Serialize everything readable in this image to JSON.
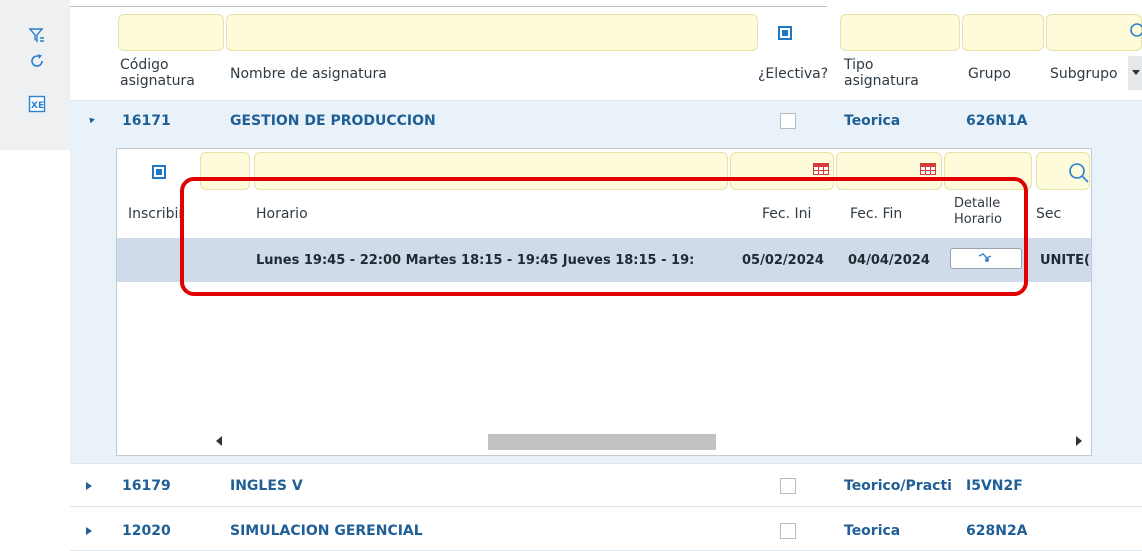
{
  "headers": {
    "codigo": "Código\nasignatura",
    "nombre": "Nombre de asignatura",
    "electiva": "¿Electiva?",
    "tipo": "Tipo\nasignatura",
    "grupo": "Grupo",
    "subgrupo": "Subgrupo"
  },
  "rows": [
    {
      "codigo": "16171",
      "nombre": "GESTION DE PRODUCCION",
      "tipo": "Teorica",
      "grupo": "626N1A",
      "expanded": true
    },
    {
      "codigo": "16179",
      "nombre": "INGLES V",
      "tipo": "Teorico/Practi",
      "grupo": "I5VN2F",
      "expanded": false
    },
    {
      "codigo": "12020",
      "nombre": "SIMULACION GERENCIAL",
      "tipo": "Teorica",
      "grupo": "628N2A",
      "expanded": false
    }
  ],
  "subtable": {
    "headers": {
      "inscribir": "Inscribir",
      "horario": "Horario",
      "fec_ini": "Fec. Ini",
      "fec_fin": "Fec. Fin",
      "detalle": "Detalle\nHorario",
      "sec": "Sec"
    },
    "row": {
      "horario": "Lunes 19:45 - 22:00 Martes 18:15 - 19:45 Jueves 18:15 - 19:",
      "fec_ini": "05/02/2024",
      "fec_fin": "04/04/2024",
      "sec": "UNITE("
    }
  },
  "colors": {
    "accent": "#1f5f95",
    "highlight": "#e00000",
    "selected_row": "#cfdbea",
    "filter": "#fdfbd9"
  },
  "icons": [
    "filter-icon",
    "refresh-icon",
    "excel-export-icon",
    "search-icon",
    "calendar-icon",
    "detail-icon",
    "chevron-left-icon",
    "chevron-right-icon",
    "expand-arrow-icon"
  ]
}
